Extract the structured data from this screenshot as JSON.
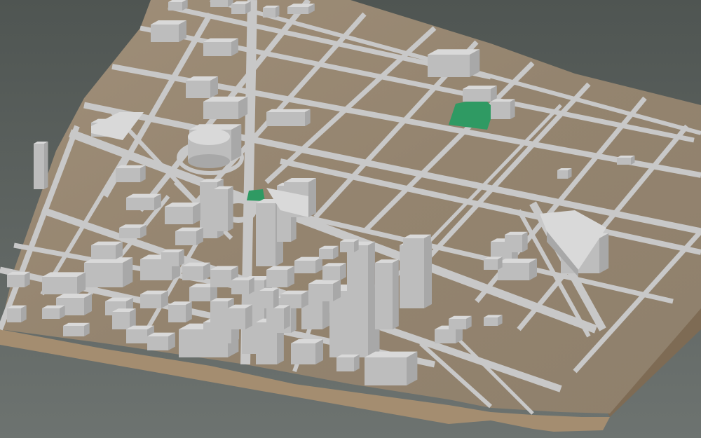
{
  "map": {
    "kind": "3d-city-block-model",
    "colors": {
      "background_top": "#4f5552",
      "background_bottom": "#6d7370",
      "terrain": "#9a8a75",
      "terrain_dark": "#8a7b67",
      "terrain_side": "#a48d70",
      "terrain_side_dark": "#7e6b54",
      "road": "#c8c8c8",
      "building_top": "#d9d9d9",
      "building_left": "#bdbdbd",
      "building_right": "#a8a8a8",
      "park": "#2f9a63"
    },
    "parks_count": 2
  }
}
